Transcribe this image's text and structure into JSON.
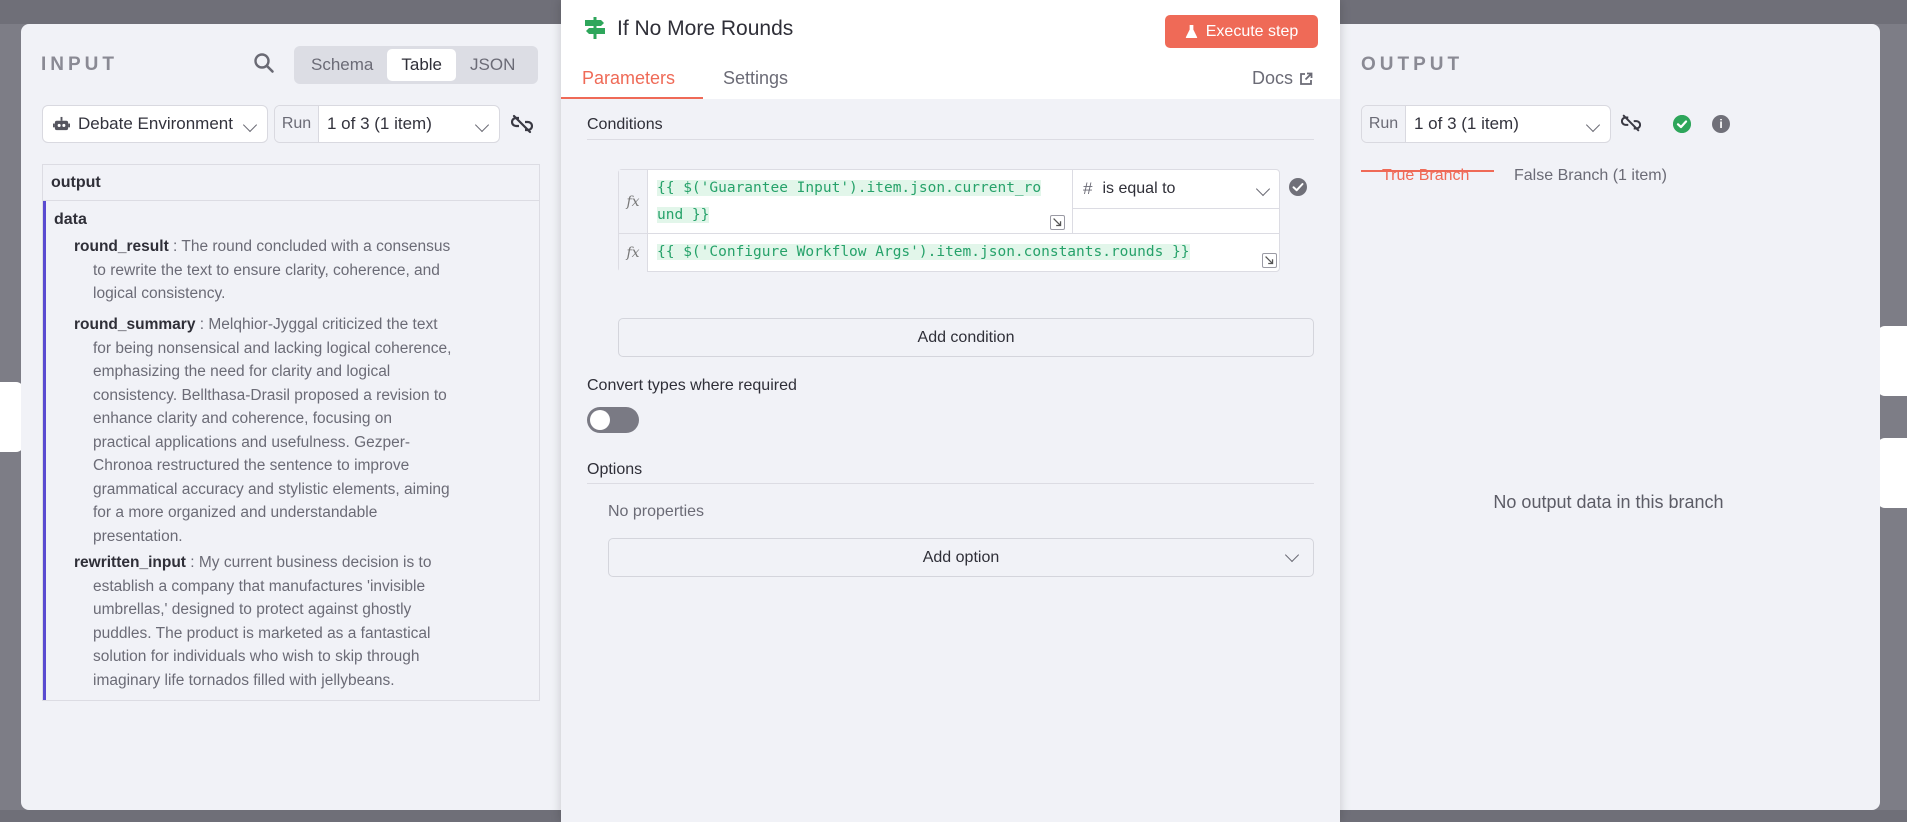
{
  "input_panel": {
    "title": "INPUT",
    "view_tabs": [
      "Schema",
      "Table",
      "JSON"
    ],
    "active_view": "Table",
    "source_node": "Debate Environment",
    "run_label": "Run",
    "run_value": "1 of 3 (1 item)",
    "table": {
      "column_header": "output",
      "group_key": "data",
      "entries": [
        {
          "key": "round_result",
          "lines": [
            "The round concluded with a consensus",
            "to rewrite the text to ensure clarity, coherence, and",
            "logical consistency."
          ]
        },
        {
          "key": "round_summary",
          "lines": [
            "Melqhior-Jyggal criticized the text",
            "for being nonsensical and lacking logical coherence,",
            "emphasizing the need for clarity and logical",
            "consistency. Bellthasa-Drasil proposed a revision to",
            "enhance clarity and coherence, focusing on",
            "practical applications and usefulness. Gezper-",
            "Chronoa restructured the sentence to improve",
            "grammatical accuracy and stylistic elements, aiming",
            "for a more organized and understandable",
            "presentation."
          ]
        },
        {
          "key": "rewritten_input",
          "lines": [
            "My current business decision is to",
            "establish a company that manufactures 'invisible",
            "umbrellas,' designed to protect against ghostly",
            "puddles. The product is marketed as a fantastical",
            "solution for individuals who wish to skip through",
            "imaginary life tornados filled with jellybeans."
          ]
        }
      ]
    }
  },
  "node_panel": {
    "title": "If No More Rounds",
    "execute_label": "Execute step",
    "tabs": [
      "Parameters",
      "Settings"
    ],
    "active_tab": "Parameters",
    "docs_label": "Docs",
    "conditions_title": "Conditions",
    "condition": {
      "left_expr_line1": "{{ $('Guarantee Input').item.json.current_ro",
      "left_expr_line2": "und }}",
      "operator_icon": "#",
      "operator": "is equal to",
      "right_expr": "{{ $('Configure Workflow Args').item.json.constants.rounds }}",
      "fx_label": "fx"
    },
    "add_condition_label": "Add condition",
    "convert_types_label": "Convert types where required",
    "convert_types_enabled": false,
    "options_title": "Options",
    "no_properties_label": "No properties",
    "add_option_label": "Add option"
  },
  "output_panel": {
    "title": "OUTPUT",
    "run_label": "Run",
    "run_value": "1 of 3 (1 item)",
    "branch_tabs": [
      "True Branch",
      "False Branch (1 item)"
    ],
    "active_branch": "True Branch",
    "empty_message": "No output data in this branch",
    "info_glyph": "i"
  },
  "colors": {
    "accent": "#ef6a57",
    "success": "#2ea65b",
    "expression_text": "#26a26a",
    "data_border": "#5a4bd1"
  }
}
